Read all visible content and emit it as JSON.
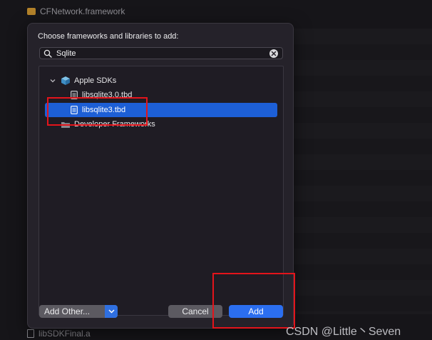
{
  "background": {
    "top_item": "CFNetwork.framework",
    "bottom_item": "libSDKFinal.a"
  },
  "dialog": {
    "title": "Choose frameworks and libraries to add:",
    "search": {
      "value": "Sqlite",
      "placeholder": ""
    },
    "tree": {
      "group_label": "Apple SDKs",
      "items": [
        "libsqlite3.0.tbd",
        "libsqlite3.tbd"
      ],
      "selected_index": 1,
      "collapsed_group_label": "Developer Frameworks"
    },
    "buttons": {
      "add_other": "Add Other...",
      "cancel": "Cancel",
      "add": "Add"
    }
  },
  "watermark": "CSDN @Little丶Seven",
  "colors": {
    "accent": "#2b6ef0",
    "selection": "#1d5fd6",
    "annotation": "#e3141b",
    "sheet_bg": "#25222a"
  }
}
